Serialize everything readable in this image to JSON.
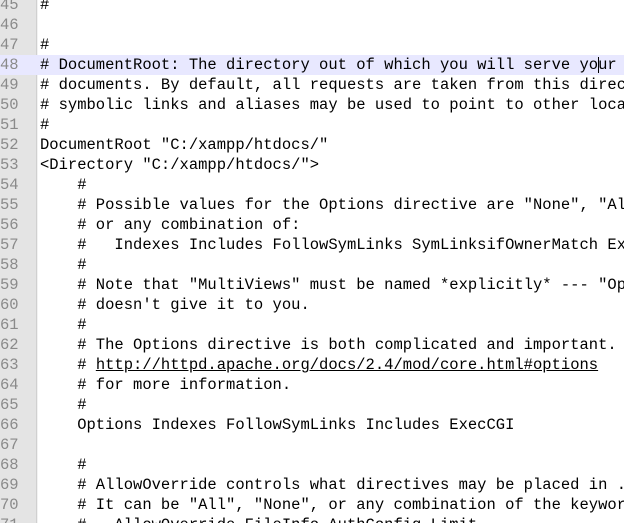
{
  "editor": {
    "current_line": 48,
    "lines": [
      {
        "n": "45",
        "t": "#"
      },
      {
        "n": "46",
        "t": ""
      },
      {
        "n": "47",
        "t": "#"
      },
      {
        "n": "48",
        "t": "# DocumentRoot: The directory out of which you will serve your"
      },
      {
        "n": "49",
        "t": "# documents. By default, all requests are taken from this directory, but"
      },
      {
        "n": "50",
        "t": "# symbolic links and aliases may be used to point to other locations."
      },
      {
        "n": "51",
        "t": "#"
      },
      {
        "n": "52",
        "t": "DocumentRoot \"C:/xampp/htdocs/\""
      },
      {
        "n": "53",
        "t": "<Directory \"C:/xampp/htdocs/\">"
      },
      {
        "n": "54",
        "t": "    #"
      },
      {
        "n": "55",
        "t": "    # Possible values for the Options directive are \"None\", \"All\","
      },
      {
        "n": "56",
        "t": "    # or any combination of:"
      },
      {
        "n": "57",
        "t": "    #   Indexes Includes FollowSymLinks SymLinksifOwnerMatch ExecCGI MultiViews"
      },
      {
        "n": "58",
        "t": "    #"
      },
      {
        "n": "59",
        "t": "    # Note that \"MultiViews\" must be named *explicitly* --- \"Options All\""
      },
      {
        "n": "60",
        "t": "    # doesn't give it to you."
      },
      {
        "n": "61",
        "t": "    #"
      },
      {
        "n": "62",
        "t": "    # The Options directive is both complicated and important.  Please see"
      },
      {
        "n": "63",
        "pre": "    # ",
        "link": "http://httpd.apache.org/docs/2.4/mod/core.html#options"
      },
      {
        "n": "64",
        "t": "    # for more information."
      },
      {
        "n": "65",
        "t": "    #"
      },
      {
        "n": "66",
        "t": "    Options Indexes FollowSymLinks Includes ExecCGI"
      },
      {
        "n": "67",
        "t": ""
      },
      {
        "n": "68",
        "t": "    #"
      },
      {
        "n": "69",
        "t": "    # AllowOverride controls what directives may be placed in .htaccess files."
      },
      {
        "n": "70",
        "t": "    # It can be \"All\", \"None\", or any combination of the keywords:"
      },
      {
        "n": "71",
        "t": "    #   AllowOverride FileInfo AuthConfig Limit"
      }
    ]
  }
}
